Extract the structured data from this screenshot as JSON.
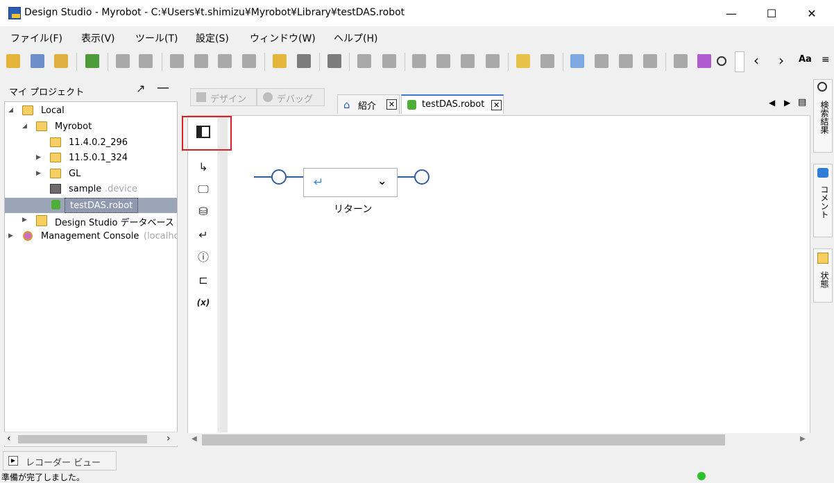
{
  "window": {
    "title": "Design Studio - Myrobot - C:¥Users¥t.shimizu¥Myrobot¥Library¥testDAS.robot",
    "minimize": "—",
    "maximize": "☐",
    "close": "✕"
  },
  "menu": [
    "ファイル(F)",
    "表示(V)",
    "ツール(T)",
    "設定(S)",
    "ウィンドウ(W)",
    "ヘルプ(H)"
  ],
  "toolbar": {
    "font_button": "Aa",
    "prev": "‹",
    "next": "›"
  },
  "left_panel": {
    "title": "マイ プロジェクト",
    "tree": [
      {
        "label": "Local"
      },
      {
        "label": "Myrobot"
      },
      {
        "label": "11.4.0.2_296"
      },
      {
        "label": "11.5.0.1_324"
      },
      {
        "label": "GL"
      },
      {
        "label": "sample",
        "suffix": ".device"
      },
      {
        "label": "testDAS.robot"
      },
      {
        "label": "Design Studio データベース"
      },
      {
        "label": "Management Console",
        "suffix": "(localhos"
      }
    ]
  },
  "editor": {
    "mode_tabs": [
      "デザイン",
      "デバッグ"
    ],
    "doc_tabs": [
      "紹介",
      "testDAS.robot"
    ],
    "node_label": "リターン",
    "node_icon": "↵",
    "node_dropdown": "⌄",
    "side_icons": [
      "↳",
      "🖵",
      "⛁",
      "↵",
      "ⓘ",
      "⊏",
      "(x)"
    ]
  },
  "right_rail": [
    "検索結果",
    "コメント",
    "状態"
  ],
  "bottom": {
    "recorder_tab": "レコーダー ビュー",
    "status": "準備が完了しました。"
  },
  "colors": {
    "accent": "#3d78d6",
    "highlight": "#e02020",
    "selection": "#9aa5b8",
    "flow_line": "#2f5f9e",
    "status_ok": "#2bc22b"
  }
}
